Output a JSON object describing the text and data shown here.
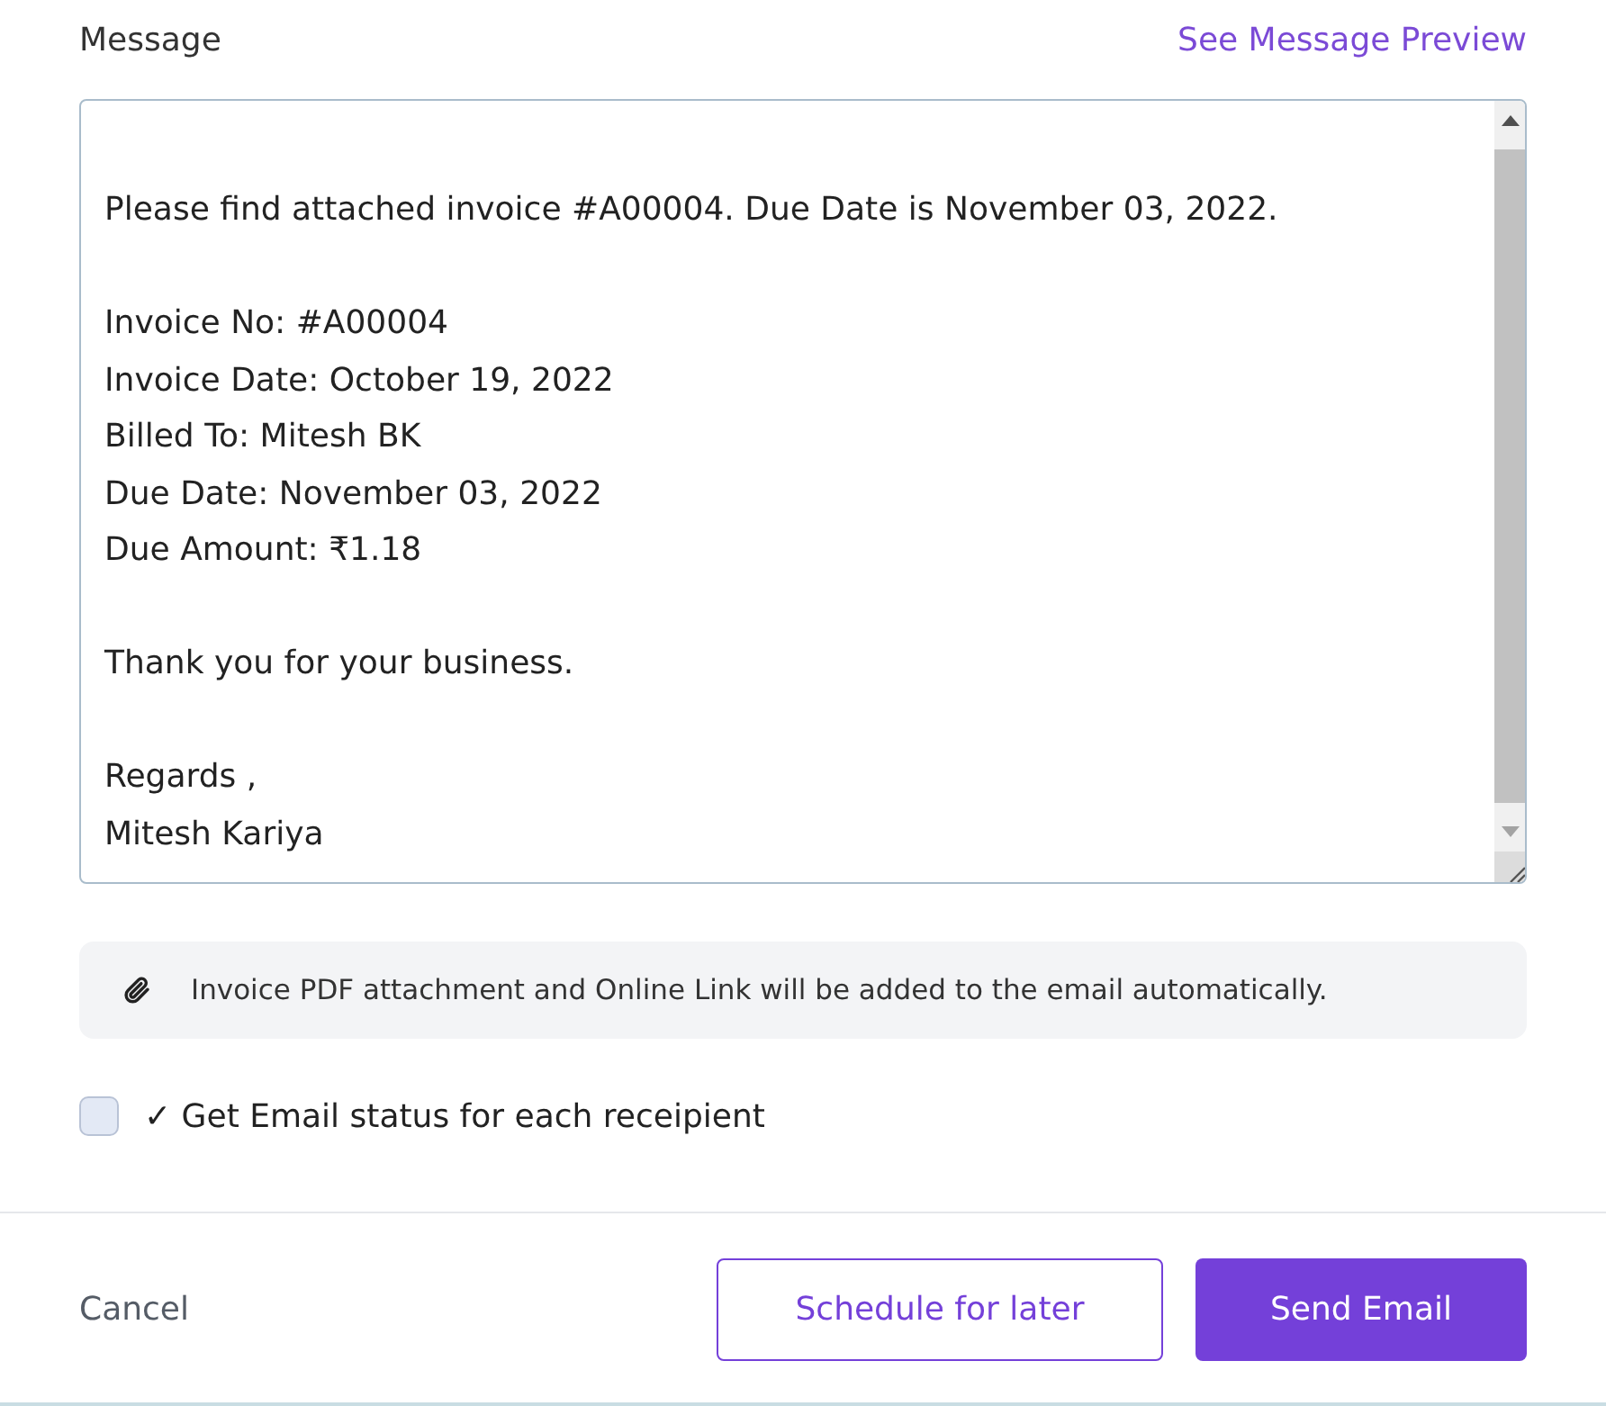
{
  "message": {
    "label": "Message",
    "preview_link": "See Message Preview",
    "paragraphs": [
      [
        "Please find attached invoice #A00004. Due Date is November 03, 2022."
      ],
      [
        "Invoice No: #A00004",
        "Invoice Date: October 19, 2022",
        "Billed To: Mitesh BK",
        "Due Date: November 03, 2022",
        "Due Amount: ₹1.18"
      ],
      [
        "Thank you for your business."
      ],
      [
        "Regards ,",
        "Mitesh Kariya"
      ]
    ]
  },
  "attachment_note": "Invoice PDF attachment and Online Link will be added to the email automatically.",
  "status_option": {
    "label": "✓ Get Email status for each receipient",
    "checked": false
  },
  "buttons": [
    {
      "kind": "link",
      "label": "Cancel"
    },
    {
      "kind": "outline",
      "label": "Schedule for later"
    },
    {
      "kind": "primary",
      "label": "Send Email"
    }
  ]
}
